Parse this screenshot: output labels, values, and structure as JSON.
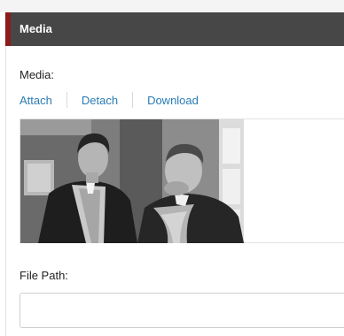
{
  "section": {
    "title": "Media"
  },
  "media_field": {
    "label": "Media:",
    "actions": {
      "attach": "Attach",
      "detach": "Detach",
      "download": "Download"
    }
  },
  "file_path_field": {
    "label": "File Path:",
    "value": ""
  },
  "colors": {
    "header_bg": "#474747",
    "header_accent": "#8c1b1b",
    "link": "#2a7bb5"
  }
}
